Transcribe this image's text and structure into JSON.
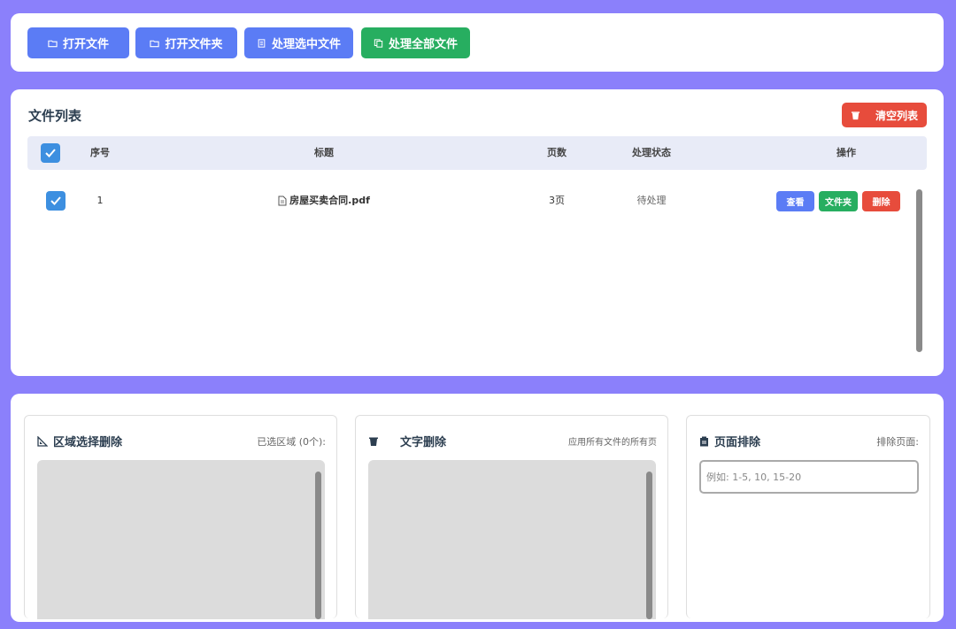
{
  "toolbar": {
    "open_file": "打开文件",
    "open_folder": "打开文件夹",
    "process_selected": "处理选中文件",
    "process_all": "处理全部文件"
  },
  "file_list": {
    "title": "文件列表",
    "clear_label": "清空列表",
    "columns": [
      "序号",
      "标题",
      "页数",
      "处理状态",
      "操作"
    ],
    "rows": [
      {
        "index": "1",
        "title": "房屋买卖合同.pdf",
        "pages": "3页",
        "status": "待处理",
        "actions": [
          "查看",
          "文件夹",
          "删除"
        ]
      }
    ]
  },
  "panels": {
    "region": {
      "title": "区域选择删除",
      "note": "已选区域 (0个):"
    },
    "text": {
      "title": "文字删除",
      "note": "应用所有文件的所有页"
    },
    "pages": {
      "title": "页面排除",
      "note": "排除页面:",
      "placeholder": "例如: 1-5, 10, 15-20",
      "value": ""
    }
  },
  "colors": {
    "primary": "#5b7cf5",
    "success": "#27ae60",
    "danger": "#e74c3c",
    "checkbox": "#3d8fe0",
    "background": "#8b80fb"
  }
}
